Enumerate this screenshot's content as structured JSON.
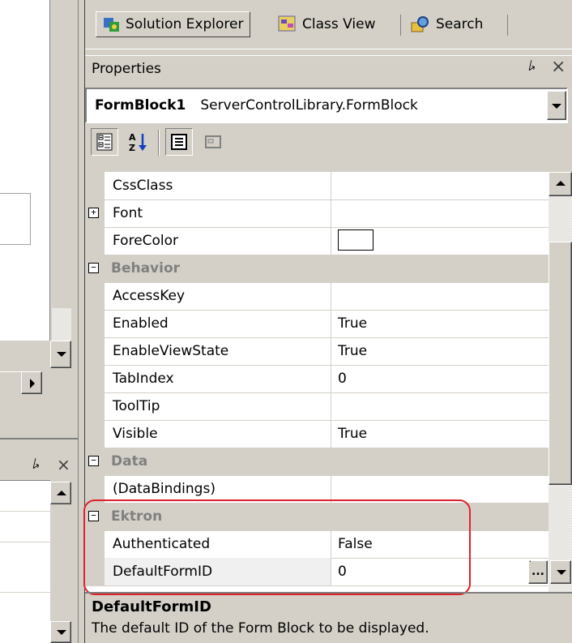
{
  "tabs": [
    {
      "label": "Solution Explorer",
      "icon": "solution-explorer-icon",
      "active": true
    },
    {
      "label": "Class View",
      "icon": "class-view-icon",
      "active": false
    },
    {
      "label": "Search",
      "icon": "search-icon",
      "active": false
    }
  ],
  "properties": {
    "title": "Properties",
    "pin_glyph": "⭞",
    "close_glyph": "×",
    "object_name": "FormBlock1",
    "object_type": "ServerControlLibrary.FormBlock"
  },
  "rows": [
    {
      "kind": "prop",
      "name": "CssClass",
      "value": ""
    },
    {
      "kind": "prop",
      "name": "Font",
      "value": "",
      "expander": "+"
    },
    {
      "kind": "prop",
      "name": "ForeColor",
      "value": "",
      "swatch": "#ffffff"
    },
    {
      "kind": "cat",
      "name": "Behavior",
      "expander": "−"
    },
    {
      "kind": "prop",
      "name": "AccessKey",
      "value": ""
    },
    {
      "kind": "prop",
      "name": "Enabled",
      "value": "True"
    },
    {
      "kind": "prop",
      "name": "EnableViewState",
      "value": "True"
    },
    {
      "kind": "prop",
      "name": "TabIndex",
      "value": "0"
    },
    {
      "kind": "prop",
      "name": "ToolTip",
      "value": ""
    },
    {
      "kind": "prop",
      "name": "Visible",
      "value": "True"
    },
    {
      "kind": "cat",
      "name": "Data",
      "expander": "−"
    },
    {
      "kind": "prop",
      "name": "(DataBindings)",
      "value": ""
    },
    {
      "kind": "cat",
      "name": "Ektron",
      "expander": "−"
    },
    {
      "kind": "prop",
      "name": "Authenticated",
      "value": "False"
    },
    {
      "kind": "prop",
      "name": "DefaultFormID",
      "value": "0",
      "ellipsis": "...",
      "selected": true
    }
  ],
  "description": {
    "title": "DefaultFormID",
    "text": "The default ID of the Form Block to be displayed."
  },
  "colors": {
    "highlight": "#e0202a",
    "face": "#d4d0c8"
  }
}
